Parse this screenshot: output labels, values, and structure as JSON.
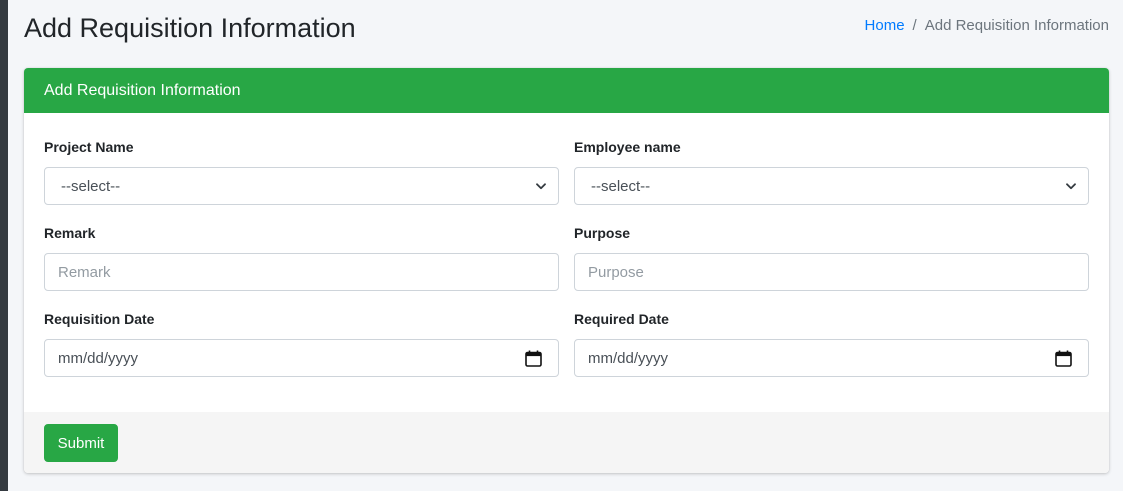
{
  "page": {
    "title": "Add Requisition Information"
  },
  "breadcrumb": {
    "home": "Home",
    "separator": "/",
    "current": "Add Requisition Information"
  },
  "card": {
    "header": "Add Requisition Information",
    "header_color": "#28a745"
  },
  "form": {
    "project_name": {
      "label": "Project Name",
      "value": "--select--"
    },
    "employee_name": {
      "label": "Employee name",
      "value": "--select--"
    },
    "remark": {
      "label": "Remark",
      "placeholder": "Remark"
    },
    "purpose": {
      "label": "Purpose",
      "placeholder": "Purpose"
    },
    "requisition_date": {
      "label": "Requisition Date",
      "value": "mm/dd/yyyy"
    },
    "required_date": {
      "label": "Required Date",
      "value": "mm/dd/yyyy"
    }
  },
  "footer": {
    "submit_label": "Submit"
  },
  "icons": {
    "select_chevron": "chevron-down-icon",
    "date_picker": "calendar-icon"
  }
}
